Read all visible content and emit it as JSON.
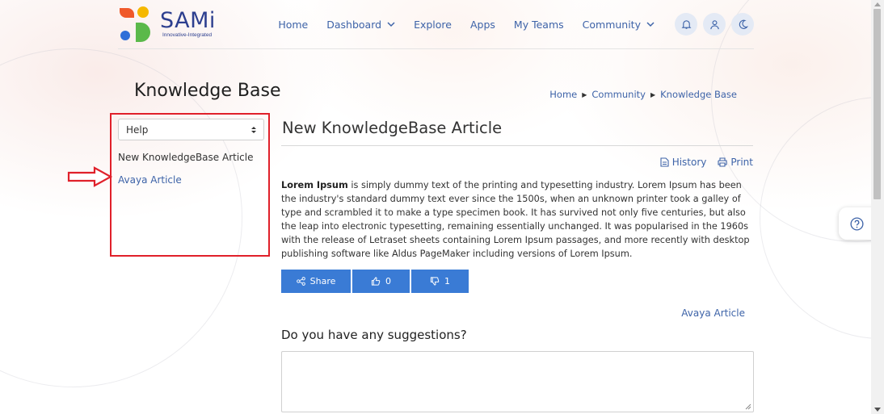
{
  "brand": {
    "name": "SAMi",
    "tagline": "Innovative-Integrated",
    "colors": {
      "orange": "#f0592a",
      "yellow": "#f5b800",
      "blue": "#2f6fd8",
      "green": "#5bb94a",
      "text": "#2d3f8f"
    }
  },
  "nav": {
    "home": "Home",
    "dashboard": "Dashboard",
    "explore": "Explore",
    "apps": "Apps",
    "my_teams": "My Teams",
    "community": "Community",
    "icons": [
      "bell-icon",
      "user-icon",
      "moon-icon"
    ]
  },
  "page": {
    "title": "Knowledge Base",
    "breadcrumb": [
      "Home",
      "Community",
      "Knowledge Base"
    ]
  },
  "sidebar": {
    "select_value": "Help",
    "heading": "New KnowledgeBase Article",
    "link": "Avaya Article",
    "highlight_color": "#e0202a"
  },
  "article": {
    "title": "New KnowledgeBase Article",
    "history_label": "History",
    "print_label": "Print",
    "lead": "Lorem Ipsum",
    "body": " is simply dummy text of the printing and typesetting industry. Lorem Ipsum has been the industry's standard dummy text ever since the 1500s, when an unknown printer took a galley of type and scrambled it to make a type specimen book. It has survived not only five centuries, but also the leap into electronic typesetting, remaining essentially unchanged. It was popularised in the 1960s with the release of Letraset sheets containing Lorem Ipsum passages, and more recently with desktop publishing software like Aldus PageMaker including versions of Lorem Ipsum.",
    "share_label": "Share",
    "likes": "0",
    "dislikes": "1",
    "related_link": "Avaya Article",
    "button_color": "#3a7bd5"
  },
  "suggestions": {
    "title": "Do you have any suggestions?",
    "value": ""
  },
  "link_color": "#3d63a8"
}
